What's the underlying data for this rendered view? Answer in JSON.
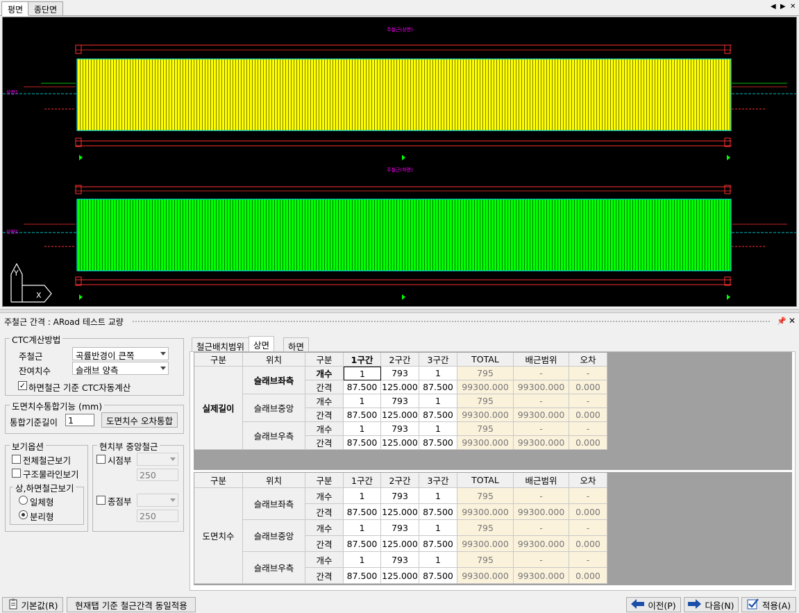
{
  "top_tabs": [
    "평면",
    "종단면"
  ],
  "drawing": {
    "top_title": "주철근(상면)",
    "bottom_title": "주철근(하면)",
    "axis_y": "Y",
    "axis_x": "X"
  },
  "panel": {
    "title": "주철근 간격 : ARoad 테스트 교량",
    "pin": "ᵖ",
    "close": "✕"
  },
  "ctc_group": {
    "title": "CTC계산방법",
    "main_rebar_label": "주철근",
    "main_rebar_value": "곡률반경이 큰쪽",
    "remain_label": "잔여치수",
    "remain_value": "슬래브 양측",
    "auto_calc_label": "하면철근 기준 CTC자동계산",
    "auto_calc_checked": true
  },
  "dim_group": {
    "title": "도면치수통합기능 (mm)",
    "base_length_label": "통합기준길이",
    "base_length_value": "1",
    "merge_button": "도면치수 오차통합"
  },
  "view_group": {
    "title": "보기옵션",
    "all_rebar": "전체철근보기",
    "struct_line": "구조물라인보기",
    "sub_title": "상,하면철근보기",
    "integrated": "일체형",
    "separated": "분리형"
  },
  "center_group": {
    "title": "현치부 중앙철근",
    "start_label": "시점부",
    "start_value": "250",
    "end_label": "종점부",
    "end_value": "250"
  },
  "right_tabs": [
    "철근배치범위",
    "상면",
    "하면"
  ],
  "columns": [
    "구분",
    "위치",
    "구분",
    "1구간",
    "2구간",
    "3구간",
    "TOTAL",
    "배근범위",
    "오차"
  ],
  "grid1": {
    "group_label": "실제길이",
    "rows": [
      {
        "pos": "슬래브좌측",
        "kind": "개수",
        "s1": "1",
        "s2": "793",
        "s3": "1",
        "total": "795",
        "range": "-",
        "err": "-"
      },
      {
        "pos": "",
        "kind": "간격",
        "s1": "87.500",
        "s2": "125.000",
        "s3": "87.500",
        "total": "99300.000",
        "range": "99300.000",
        "err": "0.000"
      },
      {
        "pos": "슬래브중앙",
        "kind": "개수",
        "s1": "1",
        "s2": "793",
        "s3": "1",
        "total": "795",
        "range": "-",
        "err": "-"
      },
      {
        "pos": "",
        "kind": "간격",
        "s1": "87.500",
        "s2": "125.000",
        "s3": "87.500",
        "total": "99300.000",
        "range": "99300.000",
        "err": "0.000"
      },
      {
        "pos": "슬래브우측",
        "kind": "개수",
        "s1": "1",
        "s2": "793",
        "s3": "1",
        "total": "795",
        "range": "-",
        "err": "-"
      },
      {
        "pos": "",
        "kind": "간격",
        "s1": "87.500",
        "s2": "125.000",
        "s3": "87.500",
        "total": "99300.000",
        "range": "99300.000",
        "err": "0.000"
      }
    ]
  },
  "grid2": {
    "group_label": "도면치수",
    "rows": [
      {
        "pos": "슬래브좌측",
        "kind": "개수",
        "s1": "1",
        "s2": "793",
        "s3": "1",
        "total": "795",
        "range": "-",
        "err": "-"
      },
      {
        "pos": "",
        "kind": "간격",
        "s1": "87.500",
        "s2": "125.000",
        "s3": "87.500",
        "total": "99300.000",
        "range": "99300.000",
        "err": "0.000"
      },
      {
        "pos": "슬래브중앙",
        "kind": "개수",
        "s1": "1",
        "s2": "793",
        "s3": "1",
        "total": "795",
        "range": "-",
        "err": "-"
      },
      {
        "pos": "",
        "kind": "간격",
        "s1": "87.500",
        "s2": "125.000",
        "s3": "87.500",
        "total": "99300.000",
        "range": "99300.000",
        "err": "0.000"
      },
      {
        "pos": "슬래브우측",
        "kind": "개수",
        "s1": "1",
        "s2": "793",
        "s3": "1",
        "total": "795",
        "range": "-",
        "err": "-"
      },
      {
        "pos": "",
        "kind": "간격",
        "s1": "87.500",
        "s2": "125.000",
        "s3": "87.500",
        "total": "99300.000",
        "range": "99300.000",
        "err": "0.000"
      }
    ]
  },
  "buttons": {
    "default": "기본값(R)",
    "apply_same": "현재탭 기준 철근간격 동일적용",
    "prev": "이전(P)",
    "next": "다음(N)",
    "apply": "적용(A)"
  },
  "colors": {
    "top_rebar": "#ffff00",
    "bottom_rebar": "#00ff00",
    "canvas_bg": "#000000",
    "readonly_cell": "#fbf2dc"
  }
}
